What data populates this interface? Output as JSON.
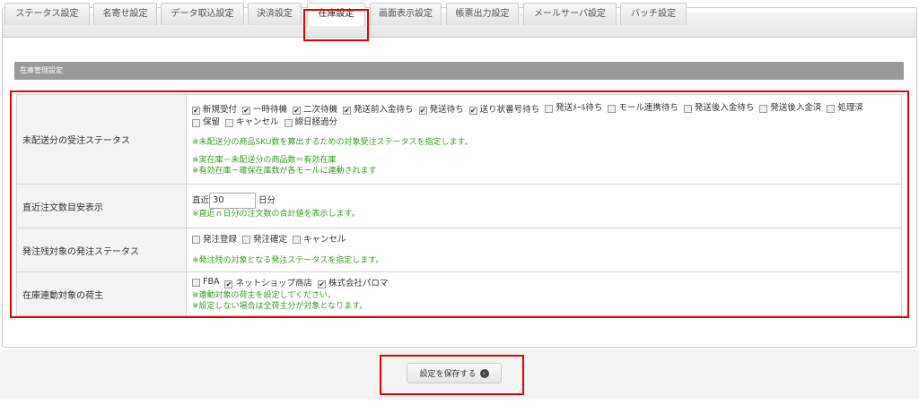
{
  "tabs": [
    "ステータス設定",
    "名寄せ設定",
    "データ取込設定",
    "決済設定",
    "在庫設定",
    "画面表示設定",
    "帳票出力設定",
    "メールサーバ設定",
    "バッチ設定"
  ],
  "section_title": "在庫管理設定",
  "rows": {
    "r1": {
      "label": "未配送分の受注ステータス",
      "options": [
        {
          "label": "新規受付",
          "checked": true
        },
        {
          "label": "一時待機",
          "checked": true
        },
        {
          "label": "二次待機",
          "checked": true
        },
        {
          "label": "発送前入金待ち",
          "checked": true
        },
        {
          "label": "発送待ち",
          "checked": true
        },
        {
          "label": "送り状番号待ち",
          "checked": true
        },
        {
          "label": "発送ﾒｰﾙ待ち",
          "checked": false
        },
        {
          "label": "モール連携待ち",
          "checked": false
        },
        {
          "label": "発送後入金待ち",
          "checked": false
        },
        {
          "label": "発送後入金済",
          "checked": false
        },
        {
          "label": "処理済",
          "checked": false
        },
        {
          "label": "保留",
          "checked": false
        },
        {
          "label": "キャンセル",
          "checked": false
        },
        {
          "label": "締日経過分",
          "checked": false
        }
      ],
      "note1": "※未配送分の商品SKU数を算出するための対象受注ステータスを指定します。",
      "note2": "※実在庫－未配送分の商品数＝有効在庫",
      "note3": "※有効在庫－確保在庫数が各モールに連動されます"
    },
    "r2": {
      "label": "直近注文数目安表示",
      "prefix": "直近",
      "value": "30",
      "suffix": "日分",
      "note": "※直近ｎ日分の注文数の合計値を表示します。"
    },
    "r3": {
      "label": "発注残対象の発注ステータス",
      "options": [
        {
          "label": "発注登録",
          "checked": false
        },
        {
          "label": "発注確定",
          "checked": false
        },
        {
          "label": "キャンセル",
          "checked": false
        }
      ],
      "note": "※発注残の対象となる発注ステータスを指定します。"
    },
    "r4": {
      "label": "在庫連動対象の荷主",
      "options": [
        {
          "label": "FBA",
          "checked": false
        },
        {
          "label": "ネットショップ商店",
          "checked": true
        },
        {
          "label": "株式会社パロマ",
          "checked": true
        }
      ],
      "note1": "※連動対象の荷主を設定してください。",
      "note2": "※設定しない場合は全荷主分が対象となります。"
    }
  },
  "save_label": "設定を保存する",
  "highlight_color": "#e00000"
}
